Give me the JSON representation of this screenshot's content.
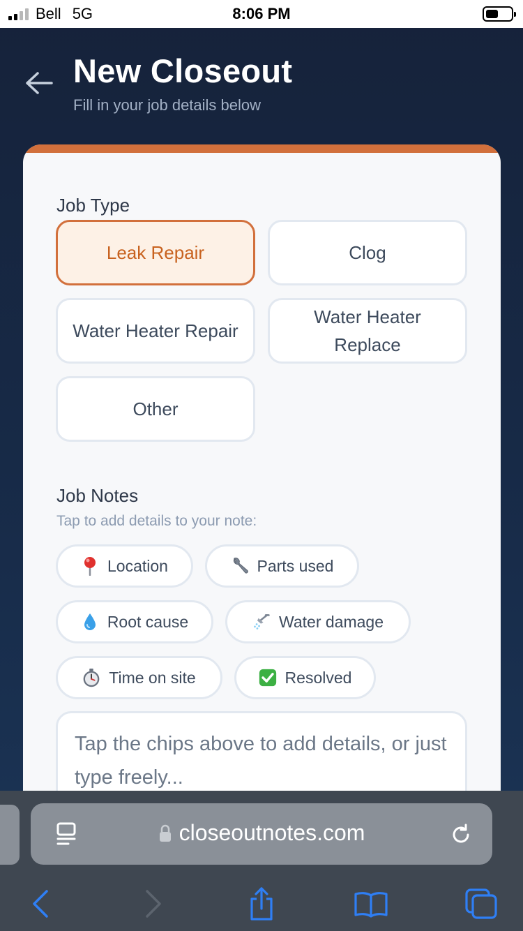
{
  "status_bar": {
    "carrier": "Bell",
    "network": "5G",
    "time": "8:06 PM",
    "battery_level": 0.5
  },
  "header": {
    "back_icon": "arrow-left-icon",
    "title": "New Closeout",
    "subtitle": "Fill in your job details below"
  },
  "job_type": {
    "label": "Job Type",
    "options": [
      {
        "label": "Leak Repair",
        "selected": true
      },
      {
        "label": "Clog",
        "selected": false
      },
      {
        "label": "Water Heater Repair",
        "selected": false
      },
      {
        "label": "Water Heater Replace",
        "selected": false
      },
      {
        "label": "Other",
        "selected": false
      }
    ]
  },
  "job_notes": {
    "label": "Job Notes",
    "hint": "Tap to add details to your note:",
    "chips": [
      {
        "label": "Location",
        "icon": "pin-icon"
      },
      {
        "label": "Parts used",
        "icon": "wrench-icon"
      },
      {
        "label": "Root cause",
        "icon": "droplet-icon"
      },
      {
        "label": "Water damage",
        "icon": "shower-icon"
      },
      {
        "label": "Time on site",
        "icon": "stopwatch-icon"
      },
      {
        "label": "Resolved",
        "icon": "check-box-icon"
      }
    ],
    "textarea_value": "",
    "textarea_placeholder": "Tap the chips above to add details, or just type freely..."
  },
  "browser": {
    "url": "closeoutnotes.com",
    "toolbar": [
      "back-icon",
      "forward-icon",
      "share-icon",
      "bookmarks-icon",
      "tabs-icon"
    ]
  },
  "colors": {
    "accent": "#d2703c",
    "selected_text": "#c8621f",
    "selected_bg": "#fdf1e6",
    "header_bg": "#172a47",
    "card_bg": "#f7f8fa",
    "ios_blue": "#2f7ff5"
  }
}
